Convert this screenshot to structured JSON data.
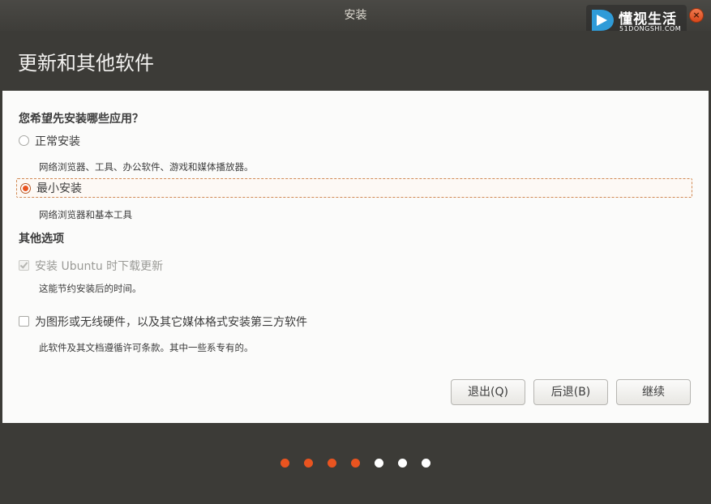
{
  "window": {
    "title": "安装"
  },
  "watermark": {
    "brand": "懂视生活",
    "domain": "51DONGSHI.COM"
  },
  "page": {
    "title": "更新和其他软件"
  },
  "install_question": "您希望先安装哪些应用？",
  "install_options": [
    {
      "label": "正常安装",
      "description": "网络浏览器、工具、办公软件、游戏和媒体播放器。",
      "selected": false
    },
    {
      "label": "最小安装",
      "description": "网络浏览器和基本工具",
      "selected": true
    }
  ],
  "other_options_title": "其他选项",
  "other_options": [
    {
      "label": "安装 Ubuntu 时下载更新",
      "description": "这能节约安装后的时间。",
      "checked": true,
      "disabled": true
    },
    {
      "label": "为图形或无线硬件，以及其它媒体格式安装第三方软件",
      "description": "此软件及其文档遵循许可条款。其中一些系专有的。",
      "checked": false,
      "disabled": false
    }
  ],
  "buttons": {
    "quit": "退出(Q)",
    "back": "后退(B)",
    "continue": "继续"
  },
  "progress": {
    "total_steps": 7,
    "completed_steps": 4,
    "active_color": "#e95420",
    "inactive_color": "#ffffff"
  },
  "colors": {
    "accent": "#e95420",
    "titlebar": "#3c3b37"
  }
}
